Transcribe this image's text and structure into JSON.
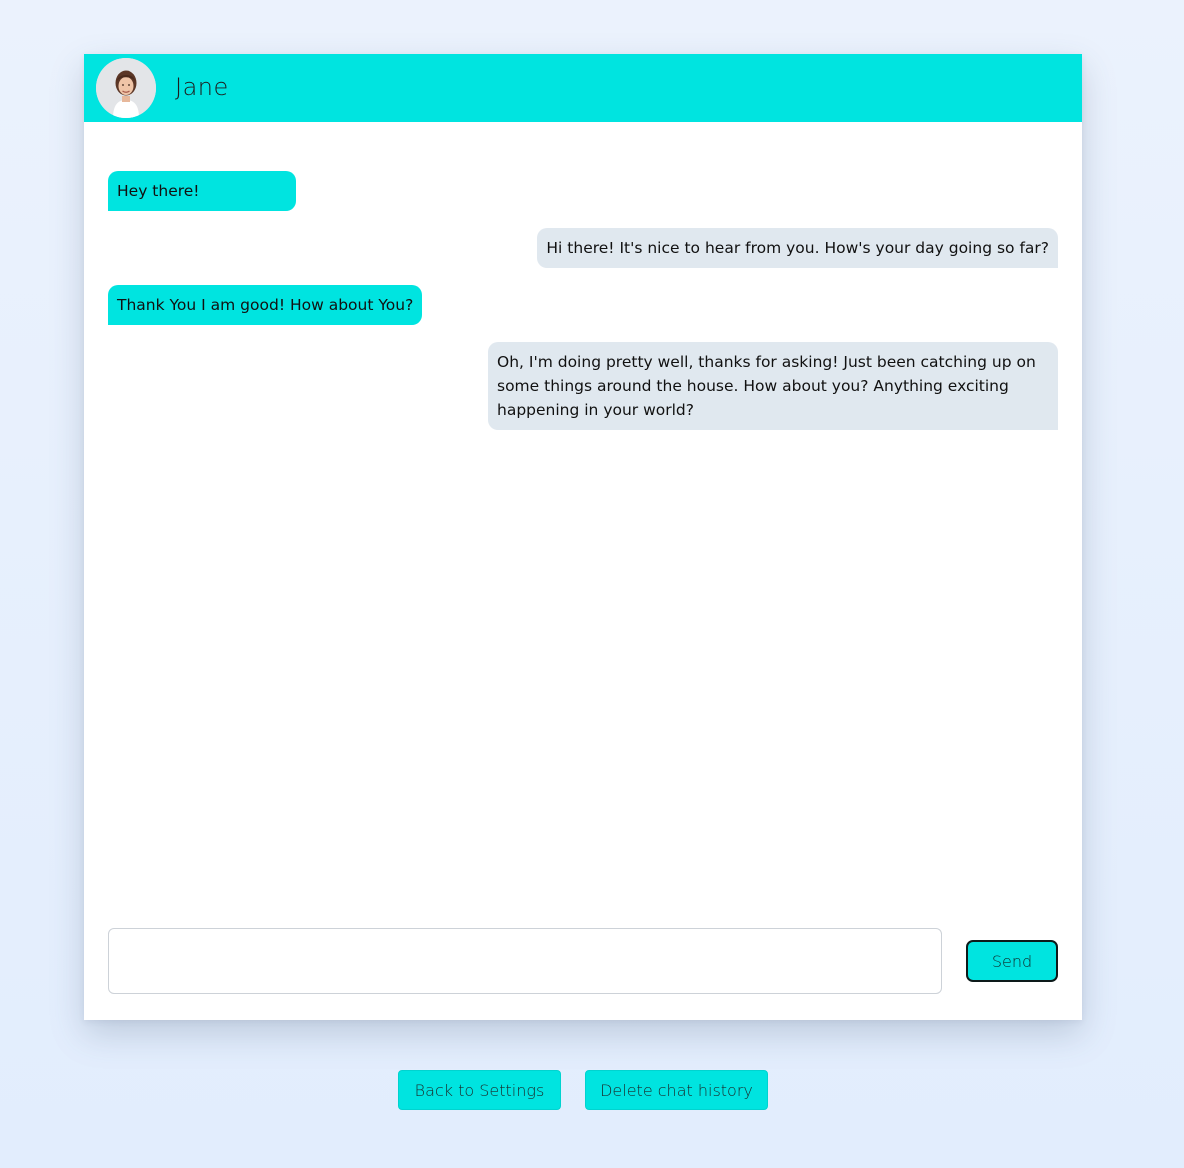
{
  "contact": {
    "name": "Jane"
  },
  "messages": [
    {
      "direction": "incoming",
      "text": "Hey there!"
    },
    {
      "direction": "outgoing",
      "text": "Hi there! It's nice to hear from you. How's your day going so far?"
    },
    {
      "direction": "incoming",
      "text": "Thank You I am good! How about You?"
    },
    {
      "direction": "outgoing",
      "text": "Oh, I'm doing pretty well, thanks for asking! Just been catching up on some things around the house. How about you? Anything exciting happening in your world?"
    }
  ],
  "composer": {
    "value": "",
    "send_label": "Send"
  },
  "footer": {
    "back_label": "Back to Settings",
    "delete_label": "Delete chat history"
  },
  "theme": {
    "accent": "#00e4e0",
    "outgoing_bubble": "#e0e8ef",
    "background": "#e6effd"
  }
}
